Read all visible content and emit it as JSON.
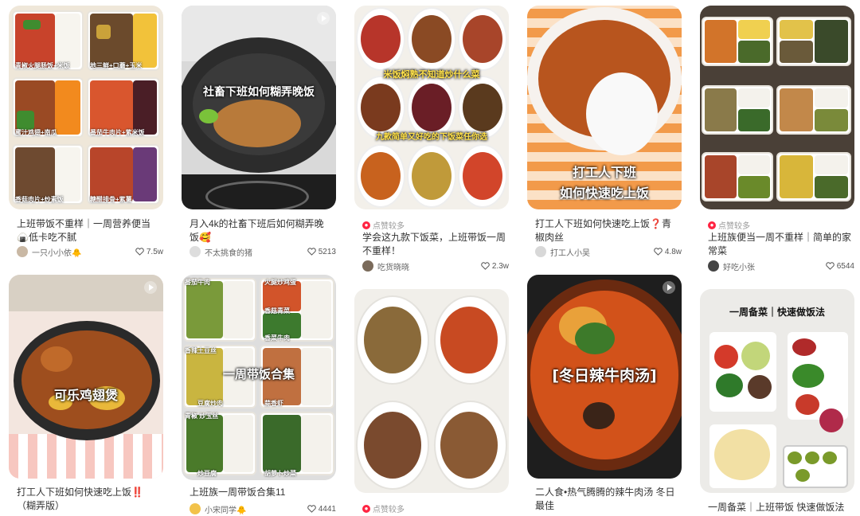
{
  "columns": [
    {
      "cards": [
        {
          "title": "上班带饭不重样｜一周营养便当🍙低卡吃不腻",
          "author": "一只小小依🐥",
          "likes": "7.5w",
          "labels": [
            "青椒火腿肠饭+米饭",
            "地三鲜+口蘑+玉米",
            "蜜汁鸡翅+南瓜",
            "番茄牛肉片+紫米饭",
            "香菇肉片+炒素饭",
            "糖醋排骨+紫薯"
          ]
        },
        {
          "title": "打工人下班如何快速吃上饭‼️（糊弄版）",
          "cover_text": "可乐鸡翅煲"
        }
      ]
    },
    {
      "cards": [
        {
          "title": "月入4k的社畜下班后如何糊弄晚饭🥰",
          "author": "不太挑食的猪",
          "likes": "5213",
          "cover_text": "社畜下班如何糊弄晚饭"
        },
        {
          "title": "上班族一周带饭合集11",
          "author": "小宋同学🐥",
          "likes": "4441",
          "cover_text": "一周带饭合集",
          "labels": [
            "番茄牛肉",
            "火腿炒鸡蛋",
            "香菜牛肉",
            "香菇青菜",
            "香辣土豆丝",
            "蒜香虾",
            "青椒 炒玉丝",
            "豆腐炒肉",
            "炒豆腐",
            "胡萝卜炒菜"
          ]
        }
      ]
    },
    {
      "cards": [
        {
          "badge": "点赞较多",
          "title": "学会这九款下饭菜，上班带饭一周不重样！",
          "author": "吃货晓晓",
          "likes": "2.3w",
          "cover_text_1": "米饭焖熟不知道炒什么菜",
          "cover_text_2": "九款简单又好吃的下饭菜任你选"
        },
        {
          "badge": "点赞较多"
        }
      ]
    },
    {
      "cards": [
        {
          "title": "打工人下班如何快速吃上饭❓青椒肉丝",
          "author": "打工人小吴",
          "likes": "4.8w",
          "cover_text_1": "打工人下班",
          "cover_text_2": "如何快速吃上饭"
        },
        {
          "title": "二人食•热气腾腾的辣牛肉汤 冬日最佳",
          "cover_text": "[冬日辣牛肉汤]"
        }
      ]
    },
    {
      "cards": [
        {
          "badge": "点赞较多",
          "title": "上班族便当一周不重样｜简单的家常菜",
          "author": "好吃小张",
          "likes": "6544"
        },
        {
          "title": "一周备菜｜上班带饭 快速做饭法",
          "cover_text": "一周备菜｜快速做饭法"
        }
      ]
    }
  ],
  "colors": {
    "accent": "#ff2442",
    "text": "#333333",
    "muted": "#999999"
  }
}
